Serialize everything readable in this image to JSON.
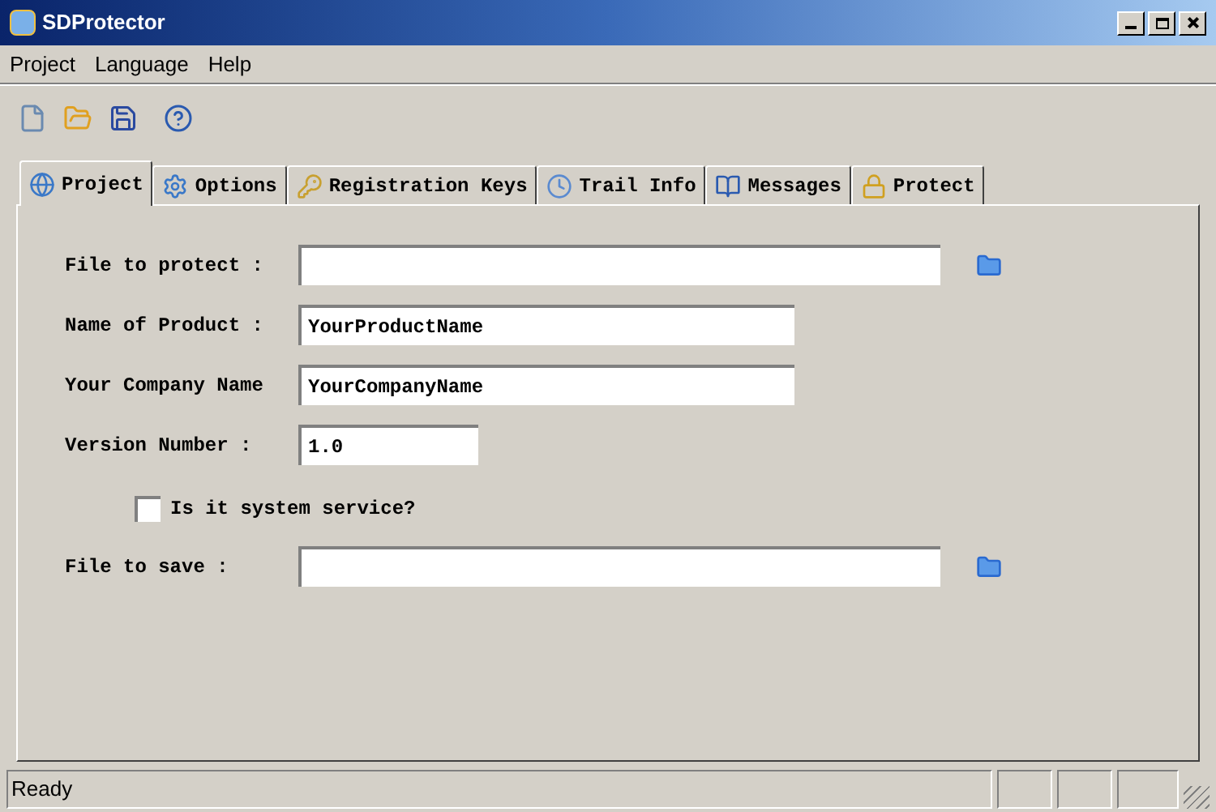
{
  "window": {
    "title": "SDProtector"
  },
  "menu": [
    "Project",
    "Language",
    "Help"
  ],
  "toolbar": [
    {
      "kind": "new"
    },
    {
      "kind": "open"
    },
    {
      "kind": "save"
    },
    {
      "kind": "help"
    }
  ],
  "tabs": [
    {
      "label": "Project",
      "kind": "globe",
      "selected": true
    },
    {
      "label": "Options",
      "kind": "gear",
      "selected": false
    },
    {
      "label": "Registration Keys",
      "kind": "keys",
      "selected": false
    },
    {
      "label": "Trail Info",
      "kind": "clock",
      "selected": false
    },
    {
      "label": "Messages",
      "kind": "book",
      "selected": false
    },
    {
      "label": "Protect",
      "kind": "lock",
      "selected": false
    }
  ],
  "form": [
    {
      "kind": "file",
      "label": "File to protect :"
    },
    {
      "kind": "text",
      "label": "Name of Product :",
      "value": "YourProductName"
    },
    {
      "kind": "text",
      "label": "Your Company Name",
      "value": "YourCompanyName"
    },
    {
      "kind": "short",
      "label": "Version Number :",
      "value": "1.0"
    },
    {
      "kind": "check",
      "label": "Is it system service?",
      "checked": false
    },
    {
      "kind": "file",
      "label": "File to save :"
    }
  ],
  "status_bar": {
    "text": "Ready"
  }
}
